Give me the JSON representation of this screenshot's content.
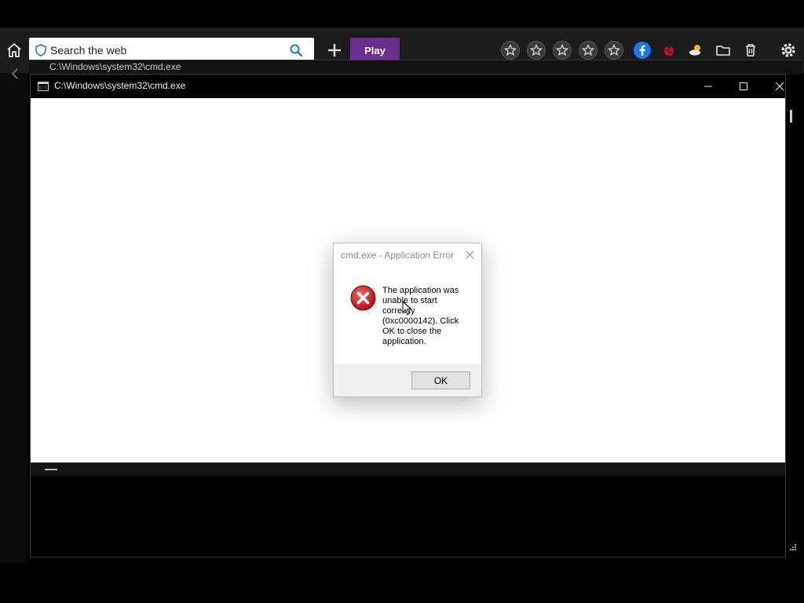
{
  "toolbar": {
    "search_placeholder": "Search the web",
    "play_label": "Play",
    "play_color": "#6b2d8e",
    "favorites": [
      "star-icon",
      "star-icon",
      "star-icon",
      "star-icon",
      "star-icon"
    ],
    "tray_icons": [
      "facebook-icon",
      "ladybug-icon",
      "weather-icon",
      "folder-icon",
      "trash-icon",
      "gear-icon"
    ]
  },
  "background_window": {
    "title": "C:\\Windows\\system32\\cmd.exe"
  },
  "cmd_window": {
    "title": "C:\\Windows\\system32\\cmd.exe",
    "buttons": [
      "minimize",
      "maximize",
      "close"
    ]
  },
  "dialog": {
    "title": "cmd.exe - Application Error",
    "message": "The application was unable to start correctly (0xc0000142). Click OK to close the application.",
    "ok_label": "OK",
    "icon": "error-icon"
  }
}
